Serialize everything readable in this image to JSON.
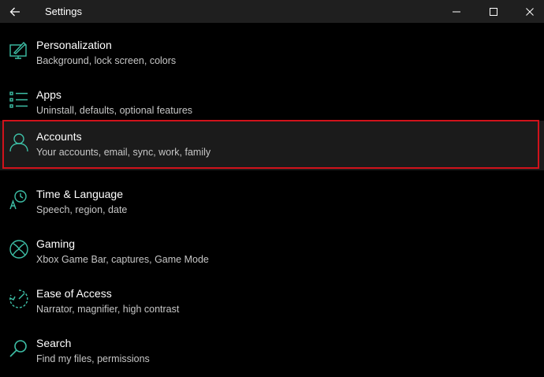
{
  "window": {
    "title": "Settings"
  },
  "colors": {
    "accent": "#3dbfa6",
    "background": "#000000",
    "titlebar": "#1f1f1f",
    "highlight_border": "#d0121b"
  },
  "items": [
    {
      "label": "Personalization",
      "desc": "Background, lock screen, colors",
      "icon": "personalization-icon"
    },
    {
      "label": "Apps",
      "desc": "Uninstall, defaults, optional features",
      "icon": "apps-icon"
    },
    {
      "label": "Accounts",
      "desc": "Your accounts, email, sync, work, family",
      "icon": "accounts-icon"
    },
    {
      "label": "Time & Language",
      "desc": "Speech, region, date",
      "icon": "time-language-icon"
    },
    {
      "label": "Gaming",
      "desc": "Xbox Game Bar, captures, Game Mode",
      "icon": "xbox-icon"
    },
    {
      "label": "Ease of Access",
      "desc": "Narrator, magnifier, high contrast",
      "icon": "ease-of-access-icon"
    },
    {
      "label": "Search",
      "desc": "Find my files, permissions",
      "icon": "search-icon"
    }
  ]
}
